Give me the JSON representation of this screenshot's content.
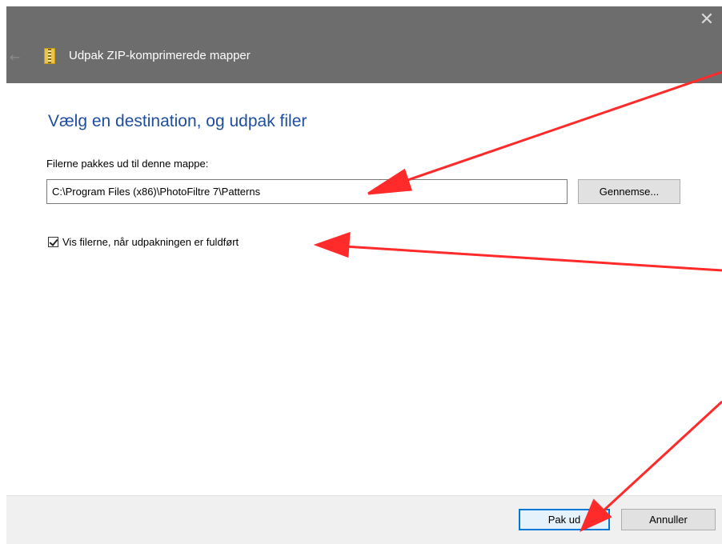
{
  "window": {
    "title": "Udpak ZIP-komprimerede mapper",
    "close_glyph": "✕",
    "back_glyph": "←"
  },
  "main": {
    "heading": "Vælg en destination, og udpak filer",
    "folder_label": "Filerne pakkes ud til denne mappe:",
    "path_value": "C:\\Program Files (x86)\\PhotoFiltre 7\\Patterns",
    "browse_label": "Gennemse...",
    "show_files_label": "Vis filerne, når udpakningen er fuldført",
    "show_files_checked": true
  },
  "footer": {
    "extract_label": "Pak ud",
    "cancel_label": "Annuller"
  },
  "colors": {
    "titlebar": "#6d6d6d",
    "heading": "#1f4ea0",
    "arrow": "#ff2a2a",
    "default_button_border": "#0078d7"
  }
}
